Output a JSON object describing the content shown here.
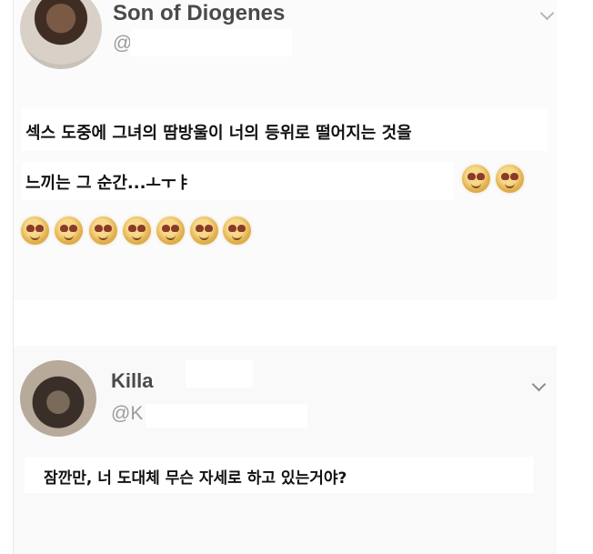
{
  "posts": [
    {
      "display_name": "Son of Diogenes",
      "handle": "@",
      "text_lines": [
        "섹스 도중에 그녀의 땀방울이 너의 등위로 떨어지는 것을",
        "느끼는 그 순간...ㅗㅜㅑ"
      ],
      "emoji_name": "heart-eyes-emoji",
      "inline_emoji_count": 2,
      "trailing_emoji_count": 7
    },
    {
      "display_name": "Killa",
      "handle": "@K",
      "text_lines": [
        "잠깐만, 너 도대체 무슨 자세로 하고 있는거야?"
      ]
    }
  ],
  "icons": {
    "menu": "chevron-down-icon"
  }
}
